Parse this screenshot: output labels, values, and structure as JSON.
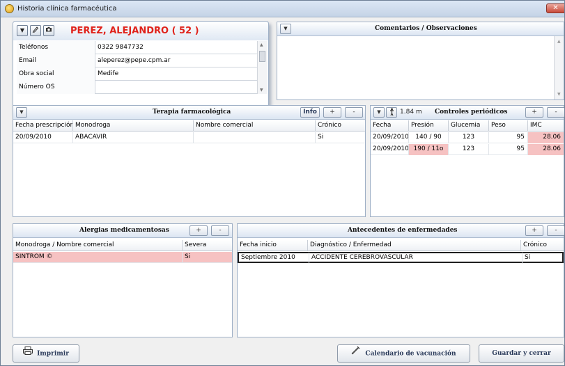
{
  "window": {
    "title": "Historia clínica farmacéutica",
    "close": "✕"
  },
  "patient": {
    "name": "PEREZ, ALEJANDRO ( 52 )",
    "rows": [
      {
        "label": "Teléfonos",
        "value": "0322 9847732"
      },
      {
        "label": "Email",
        "value": "aleperez@pepe.cpm.ar"
      },
      {
        "label": "Obra social",
        "value": "Medife"
      },
      {
        "label": "Número OS",
        "value": ""
      }
    ]
  },
  "comments": {
    "title": "Comentarios / Observaciones",
    "text": ""
  },
  "therapy": {
    "title": "Terapia farmacológica",
    "info_label": "Info",
    "add_label": "+",
    "remove_label": "-",
    "columns": [
      "Fecha prescripción",
      "Monodroga",
      "Nombre comercial",
      "Crónico"
    ],
    "rows": [
      [
        "20/09/2010",
        "ABACAVIR",
        "",
        "Si"
      ]
    ]
  },
  "controls": {
    "title": "Controles periódicos",
    "height": "1.84 m",
    "add_label": "+",
    "remove_label": "-",
    "columns": [
      "Fecha",
      "Presión",
      "Glucemia",
      "Peso",
      "IMC"
    ],
    "rows": [
      [
        "20/09/2010",
        "140 / 90",
        "123",
        "95",
        "28.06"
      ],
      [
        "20/09/2010",
        "190 / 11o",
        "123",
        "95",
        "28.06"
      ]
    ]
  },
  "allergies": {
    "title": "Alergias medicamentosas",
    "add_label": "+",
    "remove_label": "-",
    "columns": [
      "Monodroga / Nombre comercial",
      "Severa"
    ],
    "rows": [
      [
        "SINTROM ©",
        "Si"
      ]
    ]
  },
  "history": {
    "title": "Antecedentes de enfermedades",
    "add_label": "+",
    "remove_label": "-",
    "columns": [
      "Fecha inicio",
      "Diagnóstico / Enfermedad",
      "Crónico"
    ],
    "rows": [
      [
        "Septiembre 2010",
        "ACCIDENTE CEREBROVASCULAR",
        "Si"
      ]
    ]
  },
  "footer": {
    "print_label": "Imprimir",
    "vaccination_label": "Calendario de vacunación",
    "save_label": "Guardar y cerrar"
  },
  "colors": {
    "highlight": "#f6c2c2",
    "patient_name": "#e0221a",
    "accent": "#dbe5f2"
  }
}
